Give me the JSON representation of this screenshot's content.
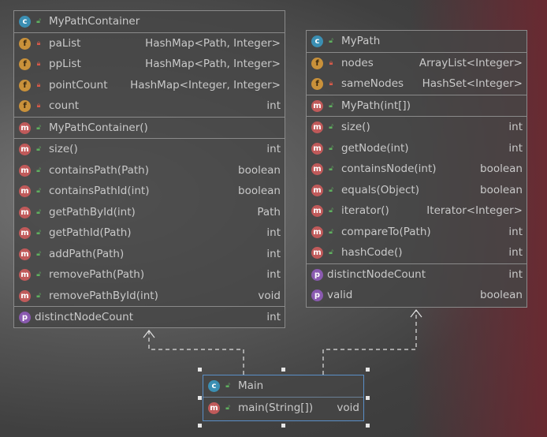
{
  "classes": {
    "container": {
      "title": "MyPathContainer",
      "fields": [
        {
          "name": "paList",
          "type": "HashMap<Path, Integer>"
        },
        {
          "name": "ppList",
          "type": "HashMap<Path, Integer>"
        },
        {
          "name": "pointCount",
          "type": "HashMap<Integer, Integer>"
        },
        {
          "name": "count",
          "type": "int"
        }
      ],
      "constructor": "MyPathContainer()",
      "methods": [
        {
          "name": "size()",
          "type": "int"
        },
        {
          "name": "containsPath(Path)",
          "type": "boolean"
        },
        {
          "name": "containsPathId(int)",
          "type": "boolean"
        },
        {
          "name": "getPathById(int)",
          "type": "Path"
        },
        {
          "name": "getPathId(Path)",
          "type": "int"
        },
        {
          "name": "addPath(Path)",
          "type": "int"
        },
        {
          "name": "removePath(Path)",
          "type": "int"
        },
        {
          "name": "removePathById(int)",
          "type": "void"
        }
      ],
      "properties": [
        {
          "name": "distinctNodeCount",
          "type": "int"
        }
      ]
    },
    "path": {
      "title": "MyPath",
      "fields": [
        {
          "name": "nodes",
          "type": "ArrayList<Integer>"
        },
        {
          "name": "sameNodes",
          "type": "HashSet<Integer>"
        }
      ],
      "constructor": "MyPath(int[])",
      "methods": [
        {
          "name": "size()",
          "type": "int"
        },
        {
          "name": "getNode(int)",
          "type": "int"
        },
        {
          "name": "containsNode(int)",
          "type": "boolean"
        },
        {
          "name": "equals(Object)",
          "type": "boolean"
        },
        {
          "name": "iterator()",
          "type": "Iterator<Integer>"
        },
        {
          "name": "compareTo(Path)",
          "type": "int"
        },
        {
          "name": "hashCode()",
          "type": "int"
        }
      ],
      "properties": [
        {
          "name": "distinctNodeCount",
          "type": "int"
        },
        {
          "name": "valid",
          "type": "boolean"
        }
      ]
    },
    "main": {
      "title": "Main",
      "methods": [
        {
          "name": "main(String[])",
          "type": "void"
        }
      ]
    }
  },
  "icons": {
    "class": "class-icon",
    "field": "field-icon",
    "method": "method-icon",
    "property": "property-icon",
    "private": "lock-icon",
    "public": "unlock-icon"
  },
  "colors": {
    "class_icon": "#3b8fb3",
    "field_icon": "#c9913a",
    "method_icon": "#c05a5a",
    "property_icon": "#8a5ab0",
    "selection_border": "#5a8fc8"
  }
}
